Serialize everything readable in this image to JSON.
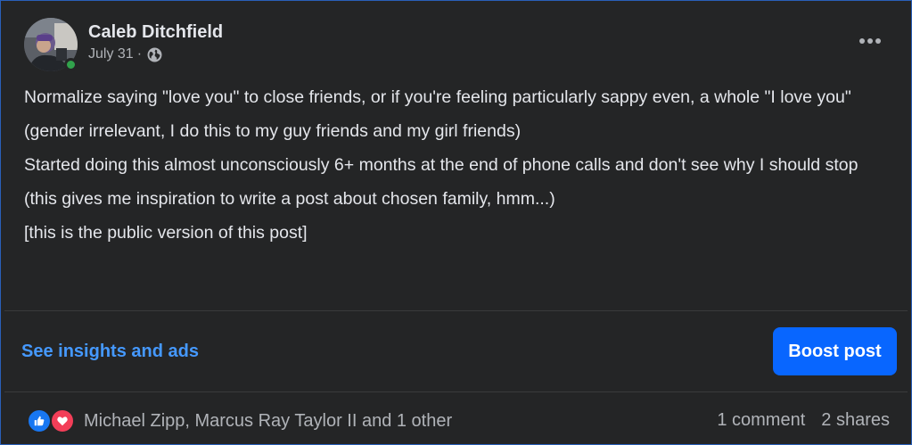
{
  "post": {
    "author": "Caleb Ditchfield",
    "date": "July 31",
    "date_separator": "·",
    "privacy_icon": "globe-icon",
    "more_icon": "more-horizontal-icon",
    "paragraphs": [
      "Normalize saying \"love you\" to close friends, or if you're feeling particularly sappy even, a whole \"I love you\"",
      "(gender irrelevant, I do this to my guy friends and my girl friends)",
      "Started doing this almost unconsciously 6+ months at the end of phone calls and don't see why I should stop",
      "(this gives me inspiration to write a post about chosen family, hmm...)",
      "[this is the public version of this post]"
    ]
  },
  "actions": {
    "insights_label": "See insights and ads",
    "boost_label": "Boost post"
  },
  "footer": {
    "reaction_icons": [
      "like-icon",
      "love-icon"
    ],
    "reactors": "Michael Zipp, Marcus Ray Taylor II and 1 other",
    "comments": "1 comment",
    "shares": "2 shares"
  },
  "colors": {
    "background": "#242526",
    "text": "#e4e6eb",
    "muted_text": "#b0b3b8",
    "link": "#4599ff",
    "primary_button": "#0866ff",
    "online": "#31a24c",
    "like": "#1877f2",
    "love": "#f33e58"
  }
}
